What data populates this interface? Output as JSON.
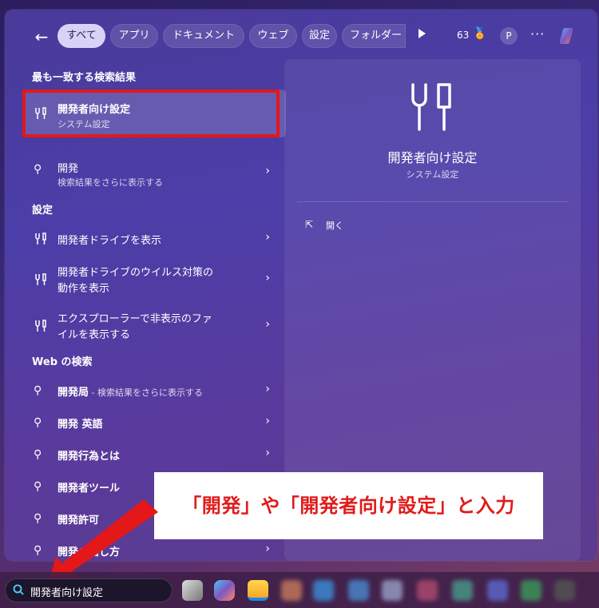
{
  "tabs": [
    {
      "label": "すべて",
      "active": true
    },
    {
      "label": "アプリ"
    },
    {
      "label": "ドキュメント"
    },
    {
      "label": "ウェブ"
    },
    {
      "label": "設定"
    },
    {
      "label": "フォルダー"
    }
  ],
  "topbar": {
    "points": "63",
    "avatar": "P",
    "more": "···"
  },
  "best_match": {
    "heading": "最も一致する検索結果",
    "title": "開発者向け設定",
    "subtitle": "システム設定"
  },
  "search_more": {
    "title": "開発",
    "subtitle": "検索結果をさらに表示する"
  },
  "settings": {
    "heading": "設定",
    "items": [
      {
        "line1": "開発者ドライブを表示",
        "line2": ""
      },
      {
        "line1": "開発者ドライブのウイルス対策の",
        "line2": "動作を表示"
      },
      {
        "line1": "エクスプローラーで非表示のファ",
        "line2": "イルを表示する"
      }
    ]
  },
  "web": {
    "heading": "Web の検索",
    "items": [
      {
        "bold": "開発局",
        "rest": " - 検索結果をさらに表示する"
      },
      {
        "bold": "開発 英語",
        "rest": ""
      },
      {
        "bold": "開発行為とは",
        "rest": ""
      },
      {
        "bold": "開発者ツール",
        "rest": ""
      },
      {
        "bold": "開発許可",
        "rest": ""
      },
      {
        "bold": "開発",
        "rest": "の出し方"
      }
    ]
  },
  "detail": {
    "title": "開発者向け設定",
    "subtitle": "システム設定",
    "open_label": "開く"
  },
  "callout": {
    "text": "「開発」や「開発者向け設定」と入力"
  },
  "taskbar": {
    "search_value": "開発者向け設定"
  },
  "colors": {
    "highlight": "#e41818",
    "callout_text": "#e01b1b"
  }
}
